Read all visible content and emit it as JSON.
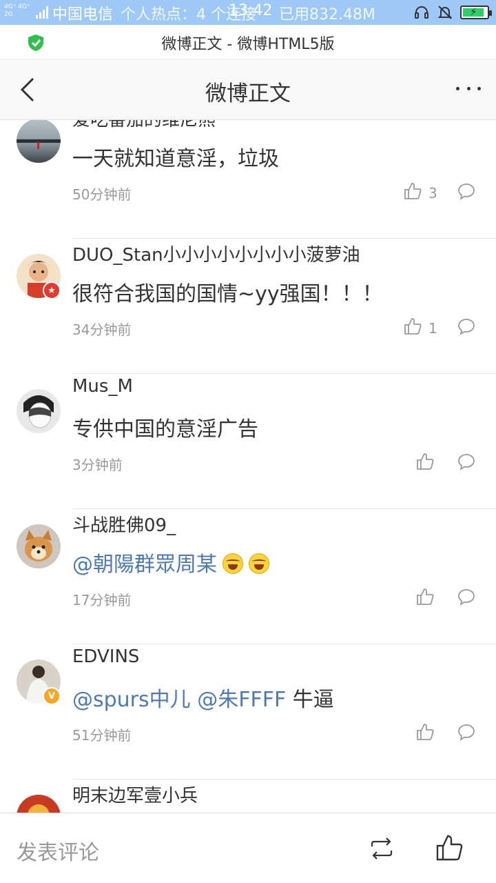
{
  "status_bar": {
    "network": "4G⁺ 4G⁺ 2G",
    "carrier": "中国电信",
    "hotspot": "个人热点：4 个连接",
    "time": "13:42",
    "memory": "已用832.48M"
  },
  "url_bar": {
    "title": "微博正文 - 微博HTML5版"
  },
  "nav": {
    "title": "微博正文"
  },
  "comments": [
    {
      "username": "爱吃番茄的维尼熊",
      "text": "一天就知道意淫，垃圾",
      "time": "50分钟前",
      "likes": "3"
    },
    {
      "username": "DUO_Stan小小小小小小小小菠萝油",
      "text": "很符合我国的国情~yy强国！！！",
      "time": "34分钟前",
      "likes": "1"
    },
    {
      "username": "Mus_M",
      "text": "专供中国的意淫广告",
      "time": "3分钟前",
      "likes": ""
    },
    {
      "username": "斗战胜佛09_",
      "mention": "@朝陽群眾周某",
      "time": "17分钟前",
      "likes": ""
    },
    {
      "username": "EDVINS",
      "mention1": "@spurs中儿",
      "mention2": "@朱FFFF",
      "text_after": " 牛逼",
      "time": "51分钟前",
      "likes": ""
    },
    {
      "username": "明末边军壹小兵"
    }
  ],
  "bottom_bar": {
    "comment_placeholder": "发表评论"
  },
  "colors": {
    "status_bar_bg": "#9ec8f5",
    "mention": "#4d7ab4",
    "secondary_text": "#999999"
  }
}
